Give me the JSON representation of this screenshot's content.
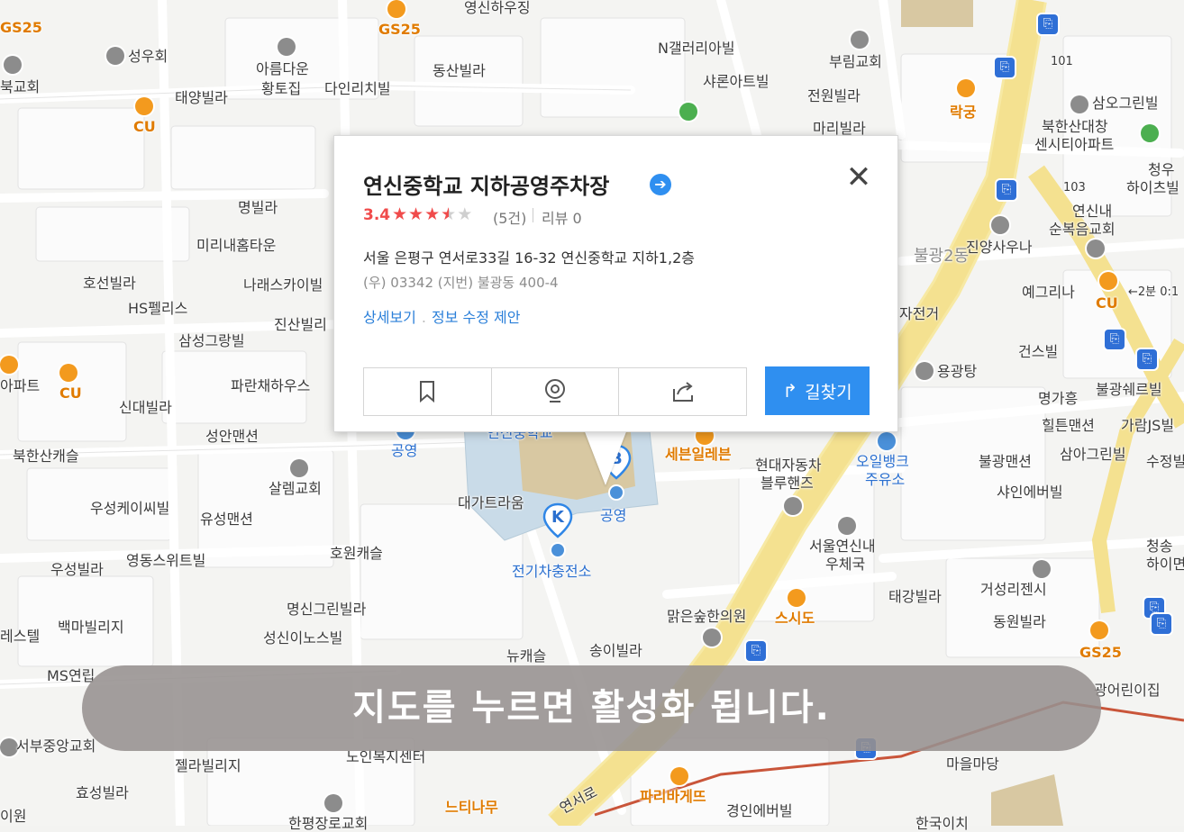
{
  "popup": {
    "title": "연신중학교 지하공영주차장",
    "rating": "3.4",
    "stars_filled": 3.5,
    "review_count": "(5건)",
    "review_label": "리뷰 0",
    "address": "서울 은평구 연서로33길 16-32 연신중학교 지하1,2층",
    "postal_and_lot": "(우) 03342   (지번) 불광동 400-4",
    "link_detail": "상세보기",
    "link_edit": "정보 수정 제안",
    "route_button": "길찾기"
  },
  "banner": "지도를 누르면 활성화 됩니다.",
  "markers": {
    "k_label": "K",
    "b_label": "B",
    "k_name": "전기차충전소",
    "b_name": "공영"
  },
  "labels": [
    "GS25",
    "영신하우징",
    "GS25",
    "N갤러리아빌",
    "부림교회",
    "101",
    "삼오그린빌",
    "성우회",
    "아름다운",
    "황토집",
    "다인리치빌",
    "동산빌라",
    "샤론아트빌",
    "전원빌라",
    "락궁",
    "북교회",
    "CU",
    "태양빌라",
    "마리빌라",
    "북한산대창",
    "센시티아파트",
    "청우",
    "하이츠빌",
    "103",
    "연신내",
    "순복음교회",
    "명빌라",
    "미리내홈타운",
    "불광2동",
    "진양사우나",
    "호선빌라",
    "나래스카이빌",
    "HS펠리스",
    "진산빌리",
    "예그리나",
    "←2분 0:1",
    "CU",
    "자전거",
    "삼성그랑빌",
    "건스빌",
    "아파트",
    "CU",
    "파란채하우스",
    "용광탕",
    "명가흥",
    "불광쉐르빌",
    "신대빌라",
    "성안맨션",
    "힐튼맨션",
    "가람JS빌",
    "북한산캐슬",
    "연신중학교",
    "세븐일레븐",
    "현대자동차",
    "블루핸즈",
    "오일뱅크",
    "주유소",
    "불광맨션",
    "삼아그린빌",
    "수정빌",
    "공영",
    "살렘교회",
    "샤인에버빌",
    "대가트라움",
    "우성케이씨빌",
    "유성맨션",
    "서울연신내",
    "우체국",
    "청송",
    "하이면",
    "호원캐슬",
    "영동스위트빌",
    "우성빌라",
    "태강빌라",
    "거성리젠시",
    "명신그린빌라",
    "스시도",
    "동원빌라",
    "GS25",
    "맑은숲한의원",
    "백마빌리지",
    "레스텔",
    "성신이노스빌",
    "뉴캐슬",
    "송이빌라",
    "MS연립",
    "광어린이집",
    "서부중앙교회",
    "노인복지센터",
    "마을마당",
    "젤라빌리지",
    "파리바게뜨",
    "효성빌라",
    "경인에버빌",
    "느티나무",
    "이원",
    "한평장로교회",
    "연서로",
    "한국이치"
  ]
}
